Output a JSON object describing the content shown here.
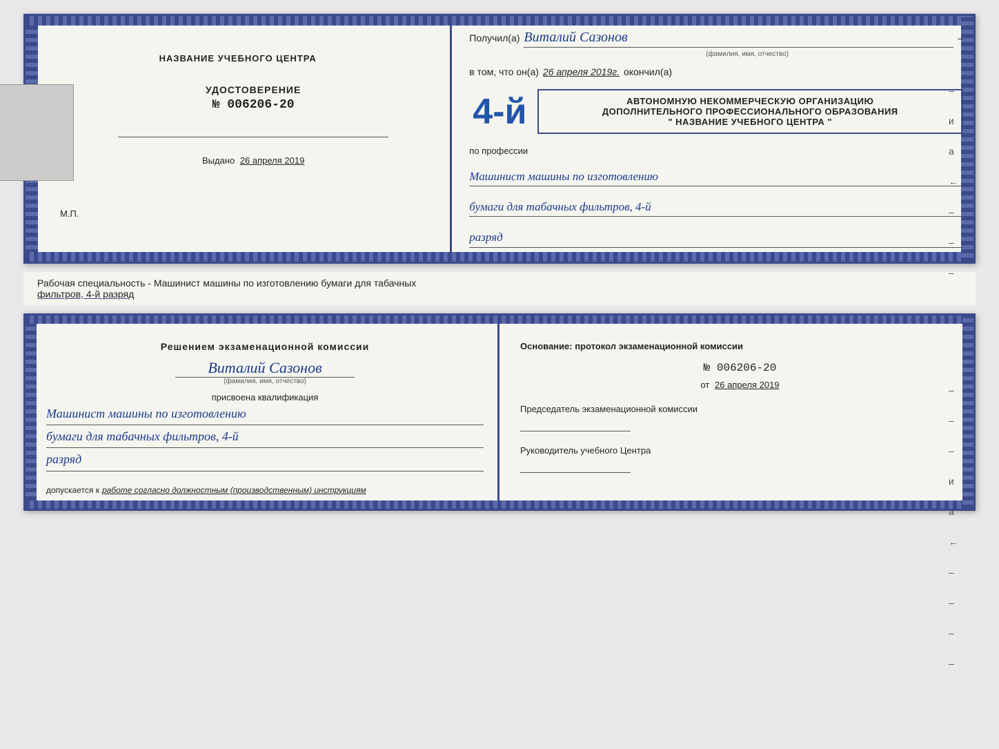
{
  "top_cert": {
    "left": {
      "center_title": "НАЗВАНИЕ УЧЕБНОГО ЦЕНТРА",
      "udostoverenie_label": "УДОСТОВЕРЕНИЕ",
      "number": "№ 006206-20",
      "vydano_label": "Выдано",
      "vydano_date": "26 апреля 2019",
      "mp": "М.П."
    },
    "right": {
      "poluchil_label": "Получил(а)",
      "recipient_name": "Виталий Сазонов",
      "recipient_hint": "(фамилия, имя, отчество)",
      "dash": "–",
      "vtom_label": "в том, что он(а)",
      "date_text": "26 апреля 2019г.",
      "okonchil_label": "окончил(а)",
      "big_number": "4-й",
      "org_line1": "АВТОНОМНУЮ НЕКОММЕРЧЕСКУЮ ОРГАНИЗАЦИЮ",
      "org_line2": "ДОПОЛНИТЕЛЬНОГО ПРОФЕССИОНАЛЬНОГО ОБРАЗОВАНИЯ",
      "org_line3": "\" НАЗВАНИЕ УЧЕБНОГО ЦЕНТРА \"",
      "i_label": "и",
      "a_label": "а",
      "left_arrow": "←",
      "po_professii": "по профессии",
      "profession_line1": "Машинист машины по изготовлению",
      "profession_line2": "бумаги для табачных фильтров, 4-й",
      "profession_line3": "разряд"
    }
  },
  "middle_band": {
    "text": "Рабочая специальность - Машинист машины по изготовлению бумаги для табачных",
    "text2": "фильтров, 4-й разряд"
  },
  "bottom_cert": {
    "left": {
      "resheniem": "Решением экзаменационной комиссии",
      "name": "Виталий Сазонов",
      "name_hint": "(фамилия, имя, отчество)",
      "prisvoena": "присвоена квалификация",
      "qual_line1": "Машинист машины по изготовлению",
      "qual_line2": "бумаги для табачных фильтров, 4-й",
      "qual_line3": "разряд",
      "dopuskaetsya_prefix": "допускается к",
      "dopuskaetsya_text": "работе согласно должностным (производственным) инструкциям"
    },
    "right": {
      "osnovanie": "Основание: протокол экзаменационной  комиссии",
      "protocol_number": "№  006206-20",
      "ot_label": "от",
      "ot_date": "26 апреля 2019",
      "predsedatel": "Председатель экзаменационной комиссии",
      "rukovoditel": "Руководитель учебного Центра",
      "i_label": "и",
      "a_label": "а",
      "left_arrow": "←"
    }
  }
}
